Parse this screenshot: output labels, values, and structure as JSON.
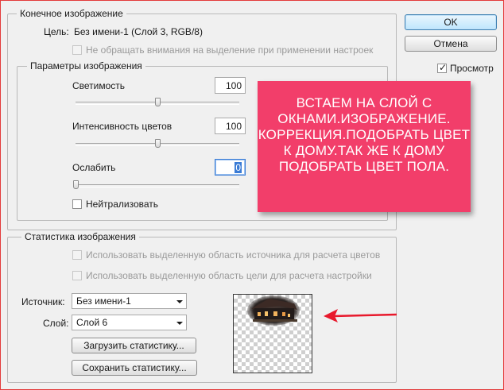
{
  "target_image": {
    "legend": "Конечное изображение",
    "target_label": "Цель:",
    "target_value": "Без имени-1 (Слой 3, RGB/8)",
    "ignore_selection_label": "Не обращать внимания на выделение при применении настроек"
  },
  "image_options": {
    "legend": "Параметры изображения",
    "luminance_label": "Светимость",
    "luminance_value": "100",
    "luminance_level": 0.5,
    "color_intensity_label": "Интенсивность цветов",
    "color_intensity_value": "100",
    "color_intensity_level": 0.5,
    "fade_label": "Ослабить",
    "fade_value": "0",
    "fade_level": 0,
    "neutralize_label": "Нейтрализовать",
    "neutralize_checked": false
  },
  "image_statistics": {
    "legend": "Статистика изображения",
    "use_source_selection_label": "Использовать выделенную область источника для расчета цветов",
    "use_target_selection_label": "Использовать выделенную область цели для расчета настройки",
    "source_label": "Источник:",
    "source_value": "Без имени-1",
    "layer_label": "Слой:",
    "layer_value": "Слой 6",
    "load_stats_label": "Загрузить статистику...",
    "save_stats_label": "Сохранить статистику..."
  },
  "buttons": {
    "ok_label": "OK",
    "cancel_label": "Отмена"
  },
  "preview": {
    "label": "Просмотр",
    "checked": true
  },
  "annotation": {
    "text": "ВСТАЕМ НА СЛОЙ С ОКНАМИ.ИЗОБРАЖЕНИЕ. КОРРЕКЦИЯ.ПОДОБРАТЬ ЦВЕТ К ДОМУ.ТАК ЖЕ К ДОМУ ПОДОБРАТЬ ЦВЕТ ПОЛА.",
    "color": "#f23e6a",
    "arrow_color": "#e8192c"
  }
}
